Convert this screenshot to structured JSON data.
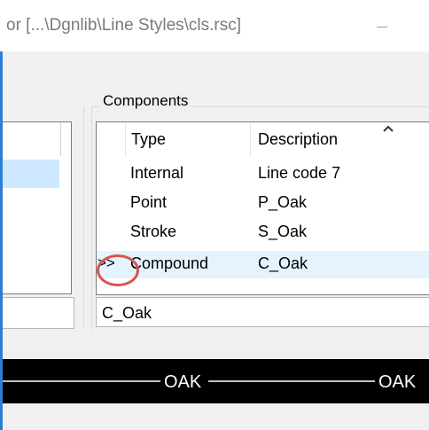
{
  "window": {
    "title": "or [...\\Dgnlib\\Line Styles\\cls.rsc]",
    "accent_color": "#2b7fd3"
  },
  "components": {
    "group_label": "Components",
    "columns": [
      "Type",
      "Description"
    ],
    "sort_icon": "chevron-up-icon",
    "rows": [
      {
        "marker": "",
        "type": "Internal",
        "description": "Line code 7",
        "selected": false
      },
      {
        "marker": "",
        "type": "Point",
        "description": "P_Oak",
        "selected": false
      },
      {
        "marker": "",
        "type": "Stroke",
        "description": "S_Oak",
        "selected": false
      },
      {
        "marker": ">>",
        "type": "Compound",
        "description": "C_Oak",
        "selected": true
      }
    ],
    "name_field": "C_Oak"
  },
  "preview": {
    "labels": [
      "OAK",
      "OAK"
    ],
    "background": "#000000",
    "line_color": "#ffffff"
  },
  "annotation_color": "#d9534f"
}
